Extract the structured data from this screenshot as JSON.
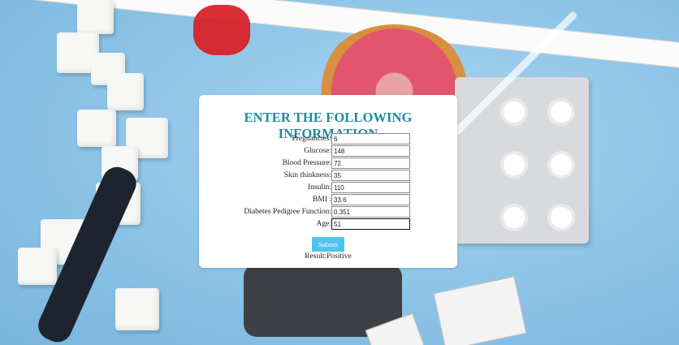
{
  "form": {
    "title": "ENTER THE FOLLOWING INFORMATION",
    "fields": [
      {
        "label": "Pregnancies:",
        "value": "6"
      },
      {
        "label": "Glucose:",
        "value": "148"
      },
      {
        "label": "Blood Pressure:",
        "value": "72"
      },
      {
        "label": "Skin thinkness:",
        "value": "35"
      },
      {
        "label": "Insulin:",
        "value": "110"
      },
      {
        "label": "BMI :",
        "value": "33.6"
      },
      {
        "label": "Diabetes Pedigree Function:",
        "value": "0.351"
      },
      {
        "label": "Age:",
        "value": "51"
      }
    ],
    "submit_label": "Submit",
    "result_text": "Result:Positive"
  },
  "colors": {
    "title": "#1f8aa5",
    "submit_bg": "#4fc3f0",
    "background": "#8ec5e8"
  }
}
